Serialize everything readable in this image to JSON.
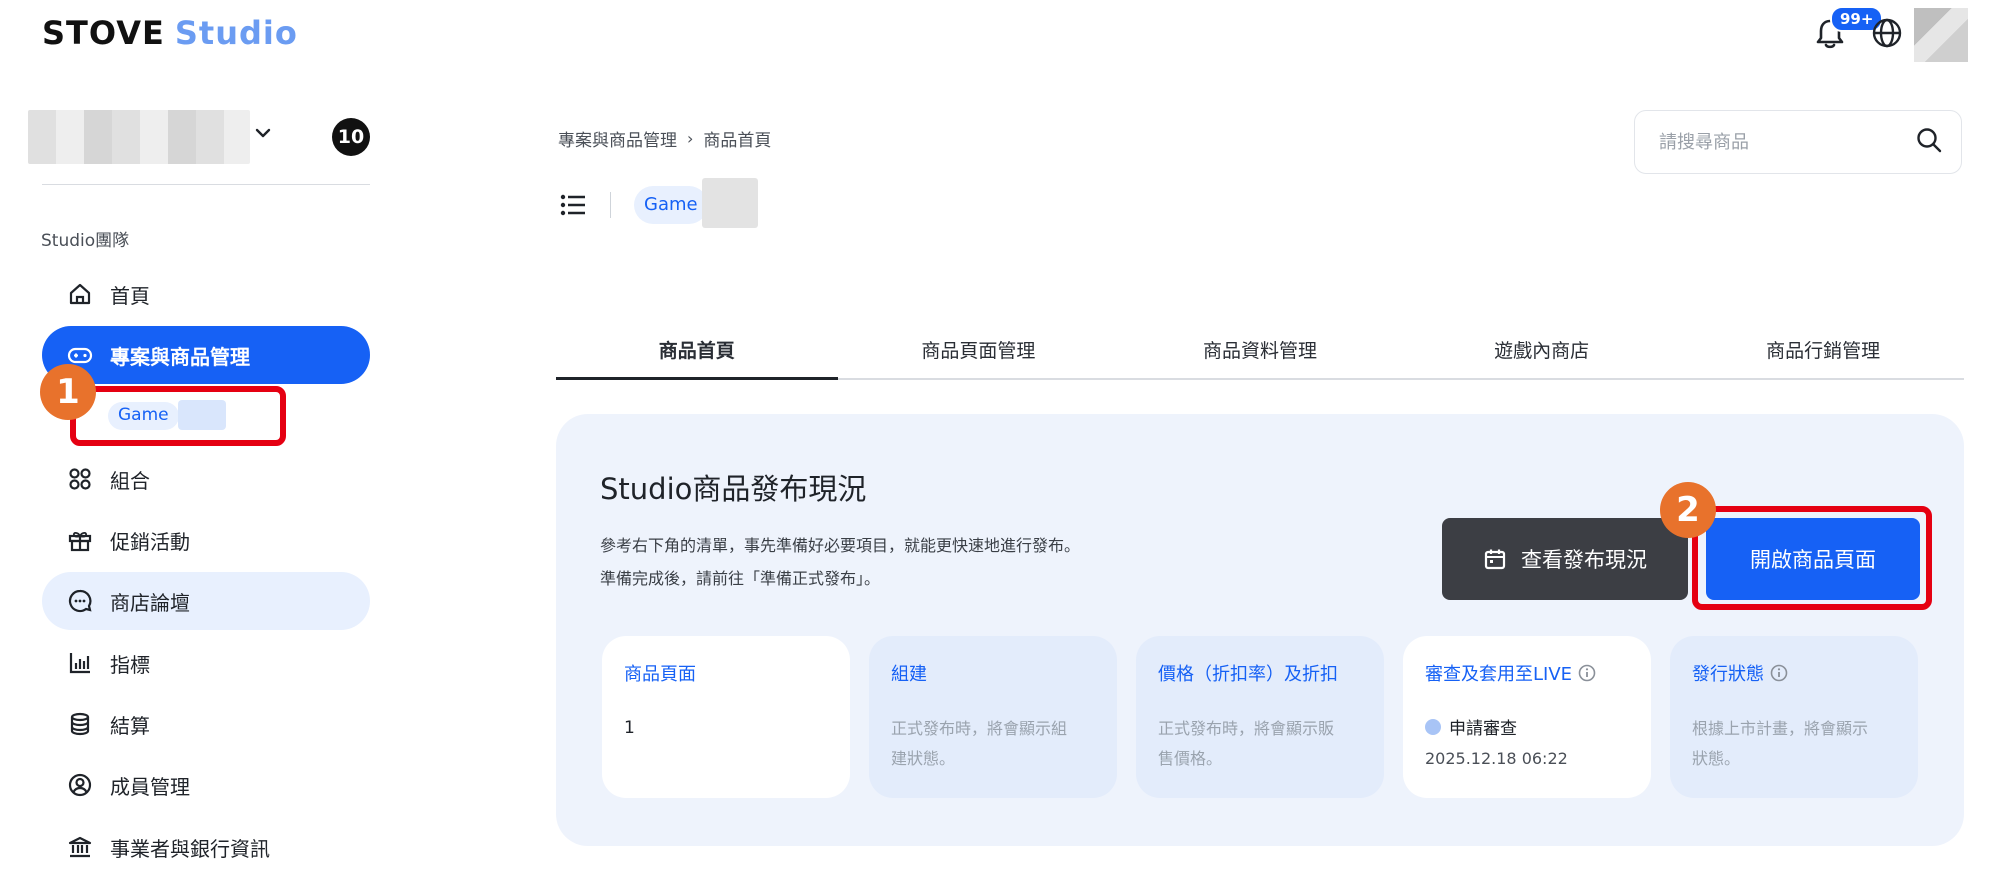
{
  "header": {
    "logo_main": "STOVE",
    "logo_sub": "Studio",
    "notification_badge": "99+",
    "icons": [
      "bell-icon",
      "globe-icon",
      "avatar"
    ]
  },
  "sidebar": {
    "team_count": "10",
    "section_label": "Studio團隊",
    "items": [
      {
        "label": "首頁",
        "icon": "home-icon"
      },
      {
        "label": "專案與商品管理",
        "icon": "gamepad-icon"
      },
      {
        "label": "組合",
        "icon": "bundle-icon"
      },
      {
        "label": "促銷活動",
        "icon": "gift-icon"
      },
      {
        "label": "商店論壇",
        "icon": "chat-icon"
      },
      {
        "label": "指標",
        "icon": "chart-icon"
      },
      {
        "label": "結算",
        "icon": "database-icon"
      },
      {
        "label": "成員管理",
        "icon": "user-circle-icon"
      },
      {
        "label": "事業者與銀行資訊",
        "icon": "bank-icon"
      }
    ],
    "sub_item_label": "Game"
  },
  "callouts": [
    "1",
    "2"
  ],
  "breadcrumb": {
    "items": [
      "專案與商品管理",
      "商品首頁"
    ],
    "separator": "›"
  },
  "product_chip": "Game",
  "search": {
    "placeholder": "請搜尋商品"
  },
  "tabs": [
    "商品首頁",
    "商品頁面管理",
    "商品資料管理",
    "遊戲內商店",
    "商品行銷管理"
  ],
  "panel": {
    "title": "Studio商品發布現況",
    "desc_line1": "參考右下角的清單，事先準備好必要項目，就能更快速地進行發布。",
    "desc_line2": "準備完成後，請前往「準備正式發布」。",
    "btn_status": "查看發布現況",
    "btn_open": "開啟商品頁面"
  },
  "cards": [
    {
      "title": "商品頁面",
      "value": "1"
    },
    {
      "title": "組建",
      "desc_l1": "正式發布時，將會顯示組",
      "desc_l2": "建狀態。"
    },
    {
      "title": "價格（折扣率）及折扣",
      "desc_l1": "正式發布時，將會顯示販",
      "desc_l2": "售價格。"
    },
    {
      "title": "審查及套用至LIVE",
      "status": "申請審查",
      "time": "2025.12.18 06:22"
    },
    {
      "title": "發行狀態",
      "desc_l1": "根據上市計畫，將會顯示",
      "desc_l2": "狀態。"
    }
  ],
  "colors": {
    "accent": "#1661f5",
    "callout_red": "#e50012",
    "callout_orange": "#e8722c",
    "panel_bg": "#eef3fc"
  }
}
